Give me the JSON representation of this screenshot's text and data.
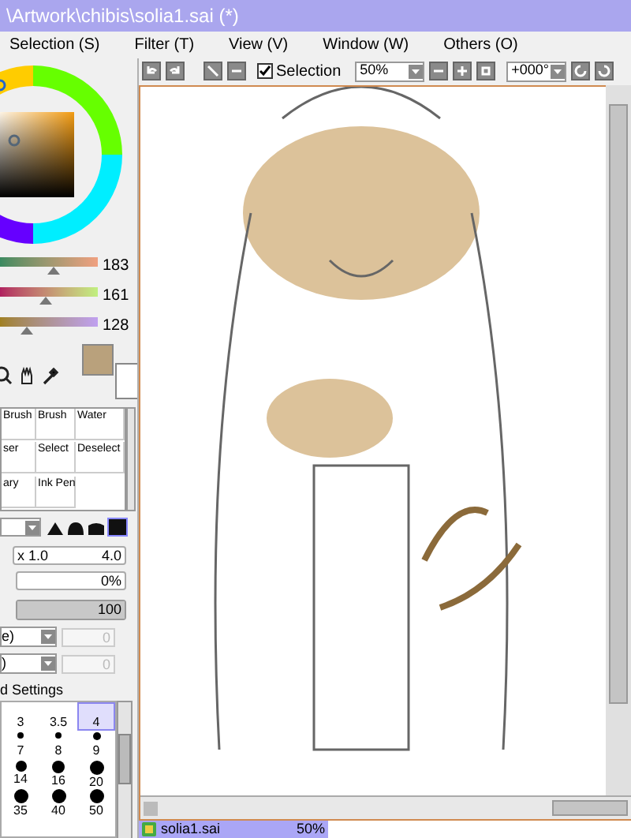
{
  "window": {
    "title": "\\Artwork\\chibis\\solia1.sai (*)"
  },
  "menu": [
    "Selection (S)",
    "Filter (T)",
    "View (V)",
    "Window (W)",
    "Others (O)"
  ],
  "toolbar": {
    "selection_checkbox": {
      "label": "Selection",
      "checked": true
    },
    "zoom": "50%",
    "rotation": "+000°"
  },
  "color_sliders": [
    {
      "reading": "183",
      "level": 0.55
    },
    {
      "reading": "161",
      "level": 0.47
    },
    {
      "reading": "128",
      "level": 0.27
    }
  ],
  "tools": [
    {
      "label": "Brush",
      "selected": false
    },
    {
      "label": "Brush",
      "selected": false
    },
    {
      "label": "Water",
      "selected": false
    },
    {
      "label": "ser",
      "selected": false
    },
    {
      "label": "Select",
      "selected": false
    },
    {
      "label": "Deselect",
      "selected": false
    },
    {
      "label": "ary",
      "selected": false
    },
    {
      "label": "Ink Pen",
      "selected": false
    }
  ],
  "brush": {
    "size_multiplier": "x 1.0",
    "size": "4.0",
    "min_size": "0%",
    "density": {
      "reading": "100",
      "level": 1
    },
    "field_1": "e)",
    "field_1_value": "0",
    "field_2": ")",
    "field_2_value": "0",
    "section": "d Settings"
  },
  "brush_sizes": [
    {
      "label": "3",
      "selected": false
    },
    {
      "label": "3.5",
      "selected": false
    },
    {
      "label": "4",
      "selected": true
    },
    {
      "label": "7",
      "selected": false
    },
    {
      "label": "8",
      "selected": false
    },
    {
      "label": "9",
      "selected": false
    },
    {
      "label": "14",
      "selected": false
    },
    {
      "label": "16",
      "selected": false
    },
    {
      "label": "20",
      "selected": false
    },
    {
      "label": "35",
      "selected": false
    },
    {
      "label": "40",
      "selected": false
    },
    {
      "label": "50",
      "selected": false
    }
  ],
  "document_tab": {
    "name": "solia1.sai",
    "zoom": "50%",
    "selected": true
  }
}
